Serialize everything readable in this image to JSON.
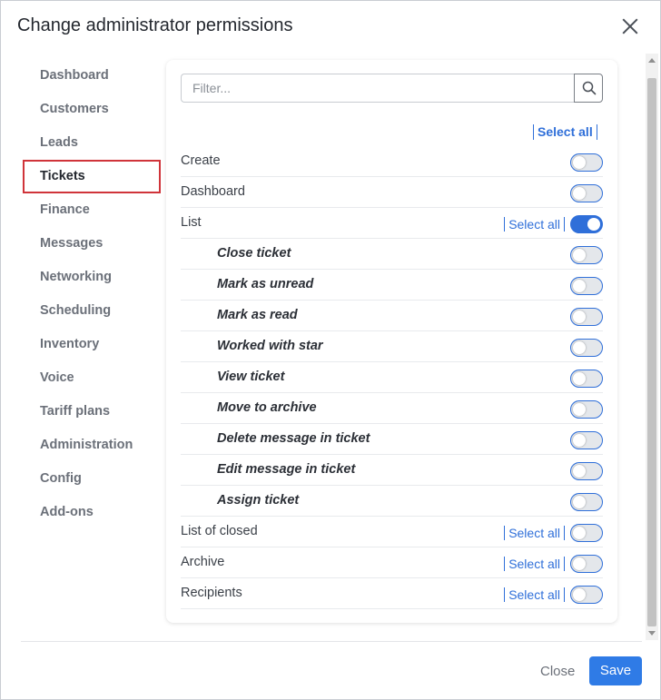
{
  "dialog": {
    "title": "Change administrator permissions"
  },
  "sidebar": {
    "items": [
      {
        "label": "Dashboard",
        "active": false
      },
      {
        "label": "Customers",
        "active": false
      },
      {
        "label": "Leads",
        "active": false
      },
      {
        "label": "Tickets",
        "active": true
      },
      {
        "label": "Finance",
        "active": false
      },
      {
        "label": "Messages",
        "active": false
      },
      {
        "label": "Networking",
        "active": false
      },
      {
        "label": "Scheduling",
        "active": false
      },
      {
        "label": "Inventory",
        "active": false
      },
      {
        "label": "Voice",
        "active": false
      },
      {
        "label": "Tariff plans",
        "active": false
      },
      {
        "label": "Administration",
        "active": false
      },
      {
        "label": "Config",
        "active": false
      },
      {
        "label": "Add-ons",
        "active": false
      }
    ]
  },
  "filter": {
    "placeholder": "Filter...",
    "value": ""
  },
  "select_all_label": "Select all",
  "permissions": [
    {
      "label": "Create",
      "level": 0,
      "enabled": false,
      "select_all": false
    },
    {
      "label": "Dashboard",
      "level": 0,
      "enabled": false,
      "select_all": false
    },
    {
      "label": "List",
      "level": 0,
      "enabled": true,
      "select_all": true
    },
    {
      "label": "Close ticket",
      "level": 1,
      "enabled": false,
      "select_all": false
    },
    {
      "label": "Mark as unread",
      "level": 1,
      "enabled": false,
      "select_all": false
    },
    {
      "label": "Mark as read",
      "level": 1,
      "enabled": false,
      "select_all": false
    },
    {
      "label": "Worked with star",
      "level": 1,
      "enabled": false,
      "select_all": false
    },
    {
      "label": "View ticket",
      "level": 1,
      "enabled": false,
      "select_all": false
    },
    {
      "label": "Move to archive",
      "level": 1,
      "enabled": false,
      "select_all": false
    },
    {
      "label": "Delete message in ticket",
      "level": 1,
      "enabled": false,
      "select_all": false
    },
    {
      "label": "Edit message in ticket",
      "level": 1,
      "enabled": false,
      "select_all": false
    },
    {
      "label": "Assign ticket",
      "level": 1,
      "enabled": false,
      "select_all": false
    },
    {
      "label": "List of closed",
      "level": 0,
      "enabled": false,
      "select_all": true
    },
    {
      "label": "Archive",
      "level": 0,
      "enabled": false,
      "select_all": true
    },
    {
      "label": "Recipients",
      "level": 0,
      "enabled": false,
      "select_all": true
    }
  ],
  "footer": {
    "close_label": "Close",
    "save_label": "Save"
  },
  "colors": {
    "accent": "#2f6fd9",
    "active_outline": "#d0343a",
    "save_button": "#2f7be6"
  }
}
